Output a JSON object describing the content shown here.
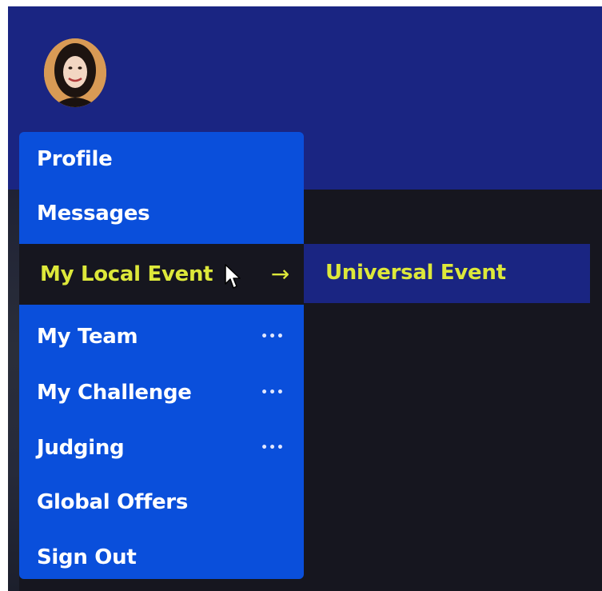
{
  "header": {
    "avatar_icon": "user-avatar-photo"
  },
  "menu": {
    "items": [
      {
        "label": "Profile",
        "more": ""
      },
      {
        "label": "Messages",
        "more": ""
      },
      {
        "label": "My Local Event",
        "arrow": "→"
      },
      {
        "label": "My Team",
        "more": "•••"
      },
      {
        "label": "My Challenge",
        "more": "•••"
      },
      {
        "label": "Judging",
        "more": "•••"
      },
      {
        "label": "Global Offers",
        "more": ""
      },
      {
        "label": "Sign Out",
        "more": ""
      }
    ]
  },
  "submenu": {
    "items": [
      {
        "label": "Universal Event"
      }
    ]
  },
  "colors": {
    "header_bg": "#1a2582",
    "menu_bg": "#0a4fdb",
    "active_bg": "#16161f",
    "highlight_text": "#dde83a"
  }
}
